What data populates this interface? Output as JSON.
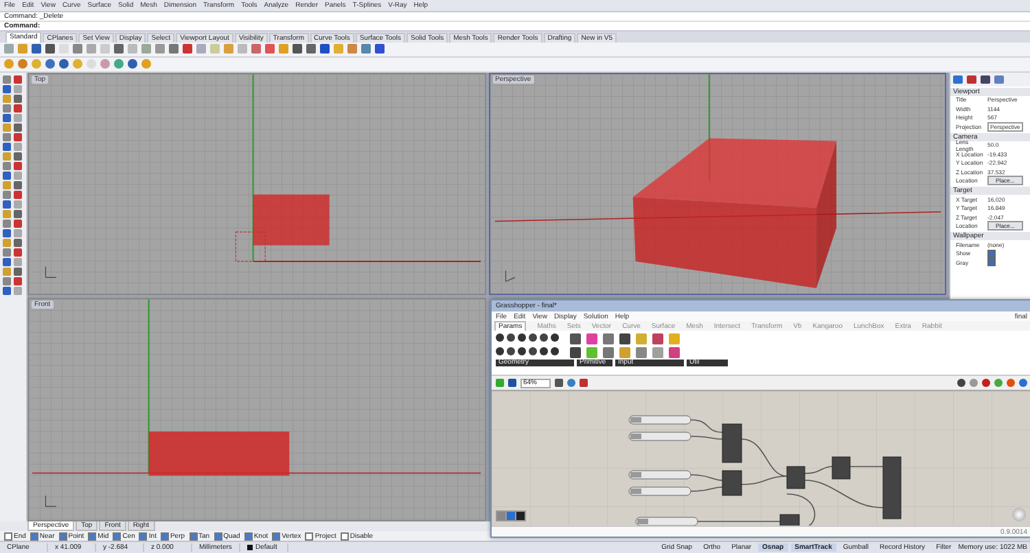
{
  "menu": [
    "File",
    "Edit",
    "View",
    "Curve",
    "Surface",
    "Solid",
    "Mesh",
    "Dimension",
    "Transform",
    "Tools",
    "Analyze",
    "Render",
    "Panels",
    "T-Splines",
    "V-Ray",
    "Help"
  ],
  "command": {
    "history": "Command: _Delete",
    "prompt": "Command:"
  },
  "toolbar_tabs": [
    {
      "label": "Standard",
      "selected": true
    },
    {
      "label": "CPlanes",
      "selected": false
    },
    {
      "label": "Set View",
      "selected": false
    },
    {
      "label": "Display",
      "selected": false
    },
    {
      "label": "Select",
      "selected": false
    },
    {
      "label": "Viewport Layout",
      "selected": false
    },
    {
      "label": "Visibility",
      "selected": false
    },
    {
      "label": "Transform",
      "selected": false
    },
    {
      "label": "Curve Tools",
      "selected": false
    },
    {
      "label": "Surface Tools",
      "selected": false
    },
    {
      "label": "Solid Tools",
      "selected": false
    },
    {
      "label": "Mesh Tools",
      "selected": false
    },
    {
      "label": "Render Tools",
      "selected": false
    },
    {
      "label": "Drafting",
      "selected": false
    },
    {
      "label": "New in V5",
      "selected": false
    }
  ],
  "viewports": [
    {
      "title": "Top",
      "kind": "top",
      "selected": false
    },
    {
      "title": "Perspective",
      "kind": "perspective",
      "selected": true
    },
    {
      "title": "Front",
      "kind": "front",
      "selected": false
    }
  ],
  "properties": {
    "sections": [
      {
        "title": "Viewport",
        "rows": [
          {
            "label": "Title",
            "value": "Perspective",
            "kind": "text"
          },
          {
            "label": "Width",
            "value": "1144",
            "kind": "text"
          },
          {
            "label": "Height",
            "value": "567",
            "kind": "text"
          },
          {
            "label": "Projection",
            "value": "Perspective",
            "kind": "dropdown"
          }
        ]
      },
      {
        "title": "Camera",
        "rows": [
          {
            "label": "Lens Length",
            "value": "50.0",
            "kind": "text"
          },
          {
            "label": "X Location",
            "value": "-19.433",
            "kind": "text"
          },
          {
            "label": "Y Location",
            "value": "-22.942",
            "kind": "text"
          },
          {
            "label": "Z Location",
            "value": "37.532",
            "kind": "text"
          },
          {
            "label": "Location",
            "value": "Place...",
            "kind": "button"
          }
        ]
      },
      {
        "title": "Target",
        "rows": [
          {
            "label": "X Target",
            "value": "16.020",
            "kind": "text"
          },
          {
            "label": "Y Target",
            "value": "16.849",
            "kind": "text"
          },
          {
            "label": "Z Target",
            "value": "-2.047",
            "kind": "text"
          },
          {
            "label": "Location",
            "value": "Place...",
            "kind": "button"
          }
        ]
      },
      {
        "title": "Wallpaper",
        "rows": [
          {
            "label": "Filename",
            "value": "(none)",
            "kind": "file"
          },
          {
            "label": "Show",
            "checked": true,
            "kind": "check"
          },
          {
            "label": "Gray",
            "checked": true,
            "kind": "check"
          }
        ]
      }
    ]
  },
  "viewport_tabs": [
    {
      "label": "Perspective",
      "selected": true
    },
    {
      "label": "Top",
      "selected": false
    },
    {
      "label": "Front",
      "selected": false
    },
    {
      "label": "Right",
      "selected": false
    }
  ],
  "osnaps": [
    {
      "label": "End",
      "checked": false
    },
    {
      "label": "Near",
      "checked": true
    },
    {
      "label": "Point",
      "checked": true
    },
    {
      "label": "Mid",
      "checked": true
    },
    {
      "label": "Cen",
      "checked": true
    },
    {
      "label": "Int",
      "checked": true
    },
    {
      "label": "Perp",
      "checked": true
    },
    {
      "label": "Tan",
      "checked": true
    },
    {
      "label": "Quad",
      "checked": true
    },
    {
      "label": "Knot",
      "checked": true
    },
    {
      "label": "Vertex",
      "checked": true
    },
    {
      "label": "Project",
      "checked": false
    },
    {
      "label": "Disable",
      "checked": false
    }
  ],
  "status_bar": {
    "fields": [
      "CPlane",
      "x 41.009",
      "y -2.684",
      "z 0.000",
      "Millimeters"
    ],
    "layer": "Default",
    "toggles": [
      {
        "label": "Grid Snap",
        "on": false
      },
      {
        "label": "Ortho",
        "on": false
      },
      {
        "label": "Planar",
        "on": false
      },
      {
        "label": "Osnap",
        "on": true
      },
      {
        "label": "SmartTrack",
        "on": true
      },
      {
        "label": "Gumball",
        "on": false
      },
      {
        "label": "Record History",
        "on": false
      },
      {
        "label": "Filter",
        "on": false
      }
    ],
    "memory": "Memory use: 1022 MB"
  },
  "grasshopper": {
    "title": "Grasshopper - final*",
    "menu": [
      "File",
      "Edit",
      "View",
      "Display",
      "Solution",
      "Help"
    ],
    "doc_name": "final",
    "tabs": [
      {
        "label": "Params",
        "selected": true
      },
      {
        "label": "Maths",
        "selected": false
      },
      {
        "label": "Sets",
        "selected": false
      },
      {
        "label": "Vector",
        "selected": false
      },
      {
        "label": "Curve",
        "selected": false
      },
      {
        "label": "Surface",
        "selected": false
      },
      {
        "label": "Mesh",
        "selected": false
      },
      {
        "label": "Intersect",
        "selected": false
      },
      {
        "label": "Transform",
        "selected": false
      },
      {
        "label": "Vb",
        "selected": false
      },
      {
        "label": "Kangaroo",
        "selected": false
      },
      {
        "label": "LunchBox",
        "selected": false
      },
      {
        "label": "Extra",
        "selected": false
      },
      {
        "label": "Rabbit",
        "selected": false
      }
    ],
    "groups": [
      "Geometry",
      "Primitive",
      "Input",
      "Util"
    ],
    "zoom": "64%",
    "version": "0.9.0014"
  }
}
